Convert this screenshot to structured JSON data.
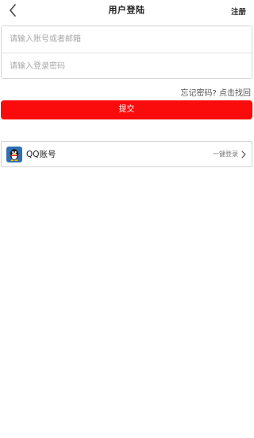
{
  "header": {
    "title": "用户登陆",
    "register_label": "注册"
  },
  "form": {
    "account_placeholder": "请输入账号或者邮箱",
    "password_placeholder": "请输入登录密码",
    "account_value": "",
    "password_value": ""
  },
  "forgot_label": "忘记密码? 点击找回",
  "submit_label": "提交",
  "qq": {
    "label": "QQ账号",
    "quick_login_label": "一键登录"
  },
  "colors": {
    "accent": "#fa0c0c",
    "qq_icon_bg": "#2f6fb3"
  },
  "icons": {
    "back": "chevron-left-icon",
    "qq": "qq-penguin-icon",
    "arrow": "chevron-right-icon"
  }
}
